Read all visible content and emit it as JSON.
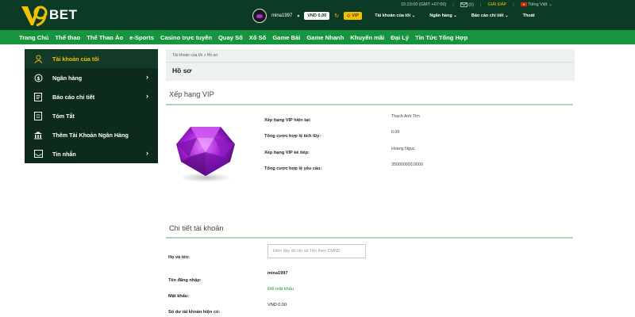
{
  "brand": {
    "name": "BET",
    "accent": "#f2c200",
    "header_bg": "#0b3a25",
    "nav_bg": "#17953e",
    "sidebar_bg": "#0d2b1d"
  },
  "clockbar": {
    "time": "15:23:00 (GMT +07:00)",
    "mail_count": "(0)",
    "support": "GIẢI ĐÁP",
    "language": "Tiếng Việt"
  },
  "user": {
    "username": "mina1997",
    "balance": "VND 0.00",
    "vip_label": "VIP"
  },
  "topmenu": [
    "Tài khoản của tôi",
    "Ngân hàng",
    "Báo cáo chi tiết",
    "Thoát"
  ],
  "nav": [
    "Trang Chủ",
    "Thể thao",
    "Thể Thao Ảo",
    "e-Sports",
    "Casino trực tuyến",
    "Quay Số",
    "Xổ Số",
    "Game Bài",
    "Game Nhanh",
    "Khuyến mãi",
    "Đại Lý",
    "Tin Tức Tổng Hợp"
  ],
  "sidebar": {
    "items": [
      {
        "label": "Tài khoản của tôi",
        "icon": "user-icon"
      },
      {
        "label": "Ngân hàng",
        "icon": "coin-icon"
      },
      {
        "label": "Báo cáo chi tiết",
        "icon": "report-icon"
      },
      {
        "label": "Tóm Tắt",
        "icon": "summary-icon"
      },
      {
        "label": "Thêm Tài Khoản Ngân Hàng",
        "icon": "bank-icon"
      },
      {
        "label": "Tin nhắn",
        "icon": "message-icon"
      }
    ]
  },
  "main": {
    "breadcrumb": "Tài khoản của tôi > Hồ sơ",
    "page_title": "Hồ sơ",
    "vip_section_title": "Xếp hạng VIP",
    "vip": [
      {
        "label": "Xếp hạng VIP hiện tại:",
        "value": "Thạch Anh Tím"
      },
      {
        "label": "Tổng cược hợp lệ tích lũy:",
        "value": "0.00"
      },
      {
        "label": "Xếp hạng VIP kế tiếp:",
        "value": "Hoàng Ngọc"
      },
      {
        "label": "Tổng cược hợp lệ yêu cầu:",
        "value": "350000000.0000"
      }
    ],
    "account_section_title": "Chi tiết tài khoản",
    "fullname_label": "Họ và tên:",
    "fullname_placeholder": "Điền đầy đủ Họ và Tên theo CMND",
    "fullname_value": "",
    "login_label": "Tên đăng nhập:",
    "login_value": "mina1997",
    "password_label": "Mật khẩu:",
    "password_link": "Đổi mật khẩu",
    "balance_label": "Số dư tài khoản hiện có:",
    "balance_value": "VND 0.00"
  }
}
